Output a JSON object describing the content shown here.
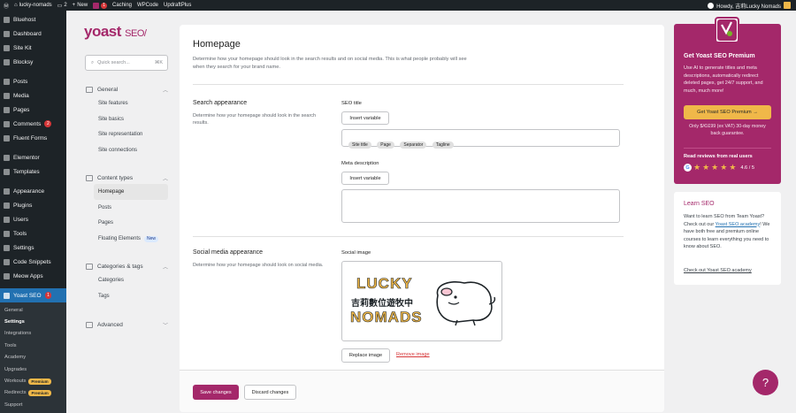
{
  "adminbar": {
    "site_name": "lucky-nomads",
    "comments_count": "2",
    "new_label": "New",
    "yoast_count": "1",
    "caching": "Caching",
    "wpcode": "WPCode",
    "updraftplus": "UpdraftPlus",
    "howdy": "Howdy, 吉莉Lucky Nomads"
  },
  "sidebar": {
    "items": [
      {
        "label": "Bluehost",
        "icon": "bluehost-icon"
      },
      {
        "label": "Dashboard",
        "icon": "dashboard-icon"
      },
      {
        "label": "Site Kit",
        "icon": "sitekit-icon"
      },
      {
        "label": "Blocksy",
        "icon": "blocksy-icon"
      },
      {
        "label": "Posts",
        "icon": "pin-icon"
      },
      {
        "label": "Media",
        "icon": "media-icon"
      },
      {
        "label": "Pages",
        "icon": "pages-icon"
      },
      {
        "label": "Comments",
        "icon": "comments-icon",
        "badge": "2"
      },
      {
        "label": "Fluent Forms",
        "icon": "forms-icon"
      },
      {
        "label": "Elementor",
        "icon": "elementor-icon"
      },
      {
        "label": "Templates",
        "icon": "templates-icon"
      },
      {
        "label": "Appearance",
        "icon": "brush-icon"
      },
      {
        "label": "Plugins",
        "icon": "plugin-icon"
      },
      {
        "label": "Users",
        "icon": "users-icon"
      },
      {
        "label": "Tools",
        "icon": "wrench-icon"
      },
      {
        "label": "Settings",
        "icon": "settings-icon"
      },
      {
        "label": "Code Snippets",
        "icon": "code-icon"
      },
      {
        "label": "Meow Apps",
        "icon": "meow-icon"
      }
    ],
    "yoast": {
      "label": "Yoast SEO",
      "badge": "1"
    },
    "subitems": [
      {
        "label": "General"
      },
      {
        "label": "Settings"
      },
      {
        "label": "Integrations"
      },
      {
        "label": "Tools"
      },
      {
        "label": "Academy"
      },
      {
        "label": "Upgrades"
      },
      {
        "label": "Workouts",
        "badge": "Premium"
      },
      {
        "label": "Redirects",
        "badge": "Premium"
      },
      {
        "label": "Support"
      }
    ]
  },
  "yoastnav": {
    "logo": "yoast",
    "logo_seo": "SEO",
    "search_placeholder": "Quick search...",
    "search_shortcut": "⌘K",
    "groups": [
      {
        "title": "General",
        "items": [
          "Site features",
          "Site basics",
          "Site representation",
          "Site connections"
        ]
      },
      {
        "title": "Content types",
        "items": [
          "Homepage",
          "Posts",
          "Pages",
          "Floating Elements"
        ],
        "new_badge": "New"
      },
      {
        "title": "Categories & tags",
        "items": [
          "Categories",
          "Tags"
        ]
      },
      {
        "title": "Advanced",
        "items": []
      }
    ]
  },
  "main": {
    "title": "Homepage",
    "lead": "Determine how your homepage should look in the search results and on social media. This is what people probably will see when they search for your brand name.",
    "search": {
      "title": "Search appearance",
      "desc": "Determine how your homepage should look in the search results.",
      "seo_title_label": "SEO title",
      "insert_variable": "Insert variable",
      "pills": [
        "Site title",
        "Page",
        "Separator",
        "Tagline"
      ],
      "meta_label": "Meta description",
      "meta_insert_variable": "Insert variable"
    },
    "social": {
      "title": "Social media appearance",
      "desc": "Determine how your homepage should look on social media.",
      "image_label": "Social image",
      "image_text_top": "LUCKY",
      "image_text_mid": "吉莉數位遊牧中",
      "image_text_bot": "NOMADS",
      "replace": "Replace image",
      "remove": "Remove image"
    },
    "save": "Save changes",
    "discard": "Discard changes"
  },
  "promo": {
    "title": "Get Yoast SEO Premium",
    "text": "Use AI to generate titles and meta descriptions, automatically redirect deleted pages, get 24/7 support, and much, much more!",
    "button": "Get Yoast SEO Premium →",
    "price": "Only $/€/£99 (ex VAT) 30-day money back guarantee.",
    "reviews": "Read reviews from real users",
    "rating": "4.6 / 5"
  },
  "learn": {
    "title": "Learn SEO",
    "text_a": "Want to learn SEO from Team Yoast? Check out our ",
    "academy": "Yoast SEO academy",
    "text_b": "! We have both free and premium online courses to learn everything you need to know about SEO.",
    "link": "Check out Yoast SEO academy"
  },
  "help": "?",
  "colors": {
    "brand": "#a4286a",
    "admin_bg": "#1d2327",
    "accent": "#2271b1",
    "cta": "#f0b849"
  }
}
